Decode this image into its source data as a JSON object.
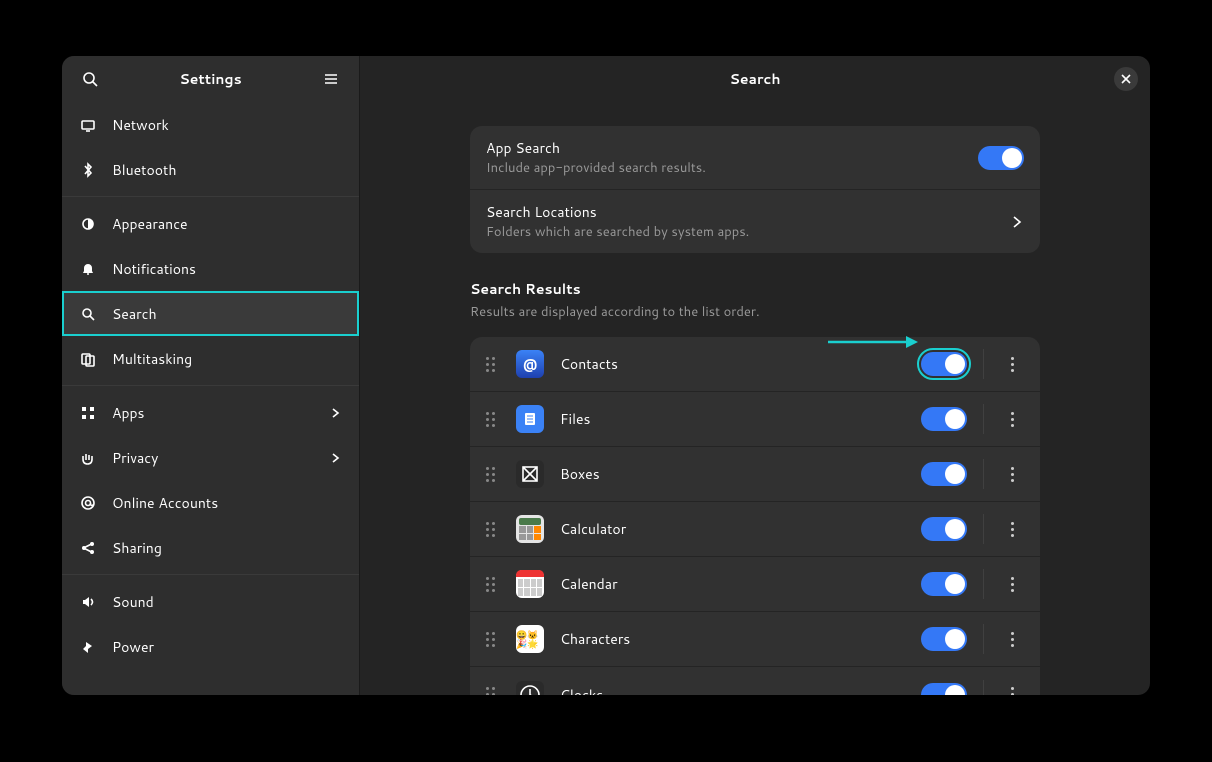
{
  "sidebar": {
    "title": "Settings",
    "items": [
      {
        "label": "Network",
        "icon": "network",
        "sep_before": false
      },
      {
        "label": "Bluetooth",
        "icon": "bluetooth",
        "sep_before": false
      },
      {
        "label": "Appearance",
        "icon": "appearance",
        "sep_before": true
      },
      {
        "label": "Notifications",
        "icon": "bell",
        "sep_before": false
      },
      {
        "label": "Search",
        "icon": "search",
        "sep_before": false,
        "active": true
      },
      {
        "label": "Multitasking",
        "icon": "multitask",
        "sep_before": false
      },
      {
        "label": "Apps",
        "icon": "grid",
        "sep_before": true,
        "chevron": true
      },
      {
        "label": "Privacy",
        "icon": "hand",
        "sep_before": false,
        "chevron": true
      },
      {
        "label": "Online Accounts",
        "icon": "at",
        "sep_before": false
      },
      {
        "label": "Sharing",
        "icon": "share",
        "sep_before": false
      },
      {
        "label": "Sound",
        "icon": "speaker",
        "sep_before": true
      },
      {
        "label": "Power",
        "icon": "power",
        "sep_before": false
      }
    ]
  },
  "main": {
    "title": "Search",
    "app_search": {
      "title": "App Search",
      "subtitle": "Include app-provided search results."
    },
    "locations": {
      "title": "Search Locations",
      "subtitle": "Folders which are searched by system apps."
    },
    "results_header": {
      "title": "Search Results",
      "subtitle": "Results are displayed according to the list order."
    },
    "results": [
      {
        "label": "Contacts",
        "icon": "contacts"
      },
      {
        "label": "Files",
        "icon": "files"
      },
      {
        "label": "Boxes",
        "icon": "boxes"
      },
      {
        "label": "Calculator",
        "icon": "calculator"
      },
      {
        "label": "Calendar",
        "icon": "calendar"
      },
      {
        "label": "Characters",
        "icon": "characters"
      },
      {
        "label": "Clocks",
        "icon": "clocks"
      }
    ]
  }
}
